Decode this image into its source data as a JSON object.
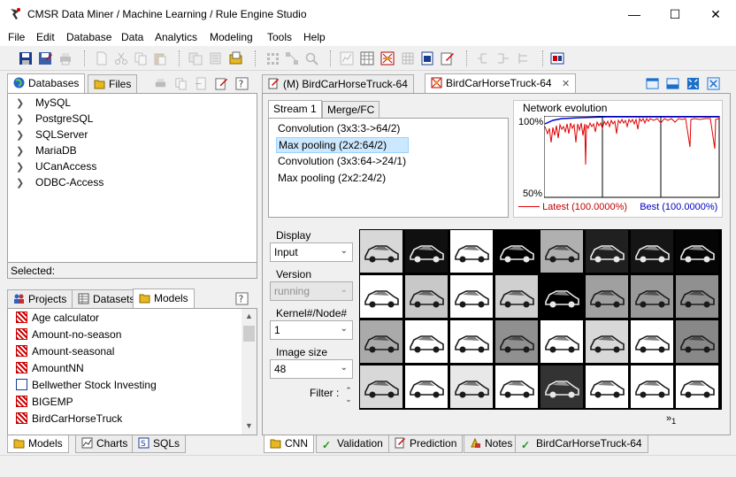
{
  "window": {
    "title": "CMSR Data Miner / Machine Learning / Rule Engine Studio"
  },
  "menu": [
    "File",
    "Edit",
    "Database",
    "Data",
    "Analytics",
    "Modeling",
    "Tools",
    "Help"
  ],
  "left_top_tabs": {
    "databases": "Databases",
    "files": "Files"
  },
  "databases": [
    "MySQL",
    "PostgreSQL",
    "SQLServer",
    "MariaDB",
    "UCanAccess",
    "ODBC-Access"
  ],
  "selected_label": "Selected:",
  "left_mid_tabs": {
    "projects": "Projects",
    "datasets": "Datasets",
    "models": "Models"
  },
  "models_list": [
    {
      "label": "Age calculator",
      "icon": "neural"
    },
    {
      "label": "Amount-no-season",
      "icon": "neural"
    },
    {
      "label": "Amount-seasonal",
      "icon": "neural"
    },
    {
      "label": "AmountNN",
      "icon": "neural"
    },
    {
      "label": "Bellwether Stock Investing",
      "icon": "doc"
    },
    {
      "label": "BIGEMP",
      "icon": "neural"
    },
    {
      "label": "BirdCarHorseTruck",
      "icon": "neural"
    }
  ],
  "left_bottom_tabs": {
    "models": "Models",
    "charts": "Charts",
    "sqls": "SQLs"
  },
  "editor_tabs": {
    "tab1": "(M) BirdCarHorseTruck-64",
    "tab2": "BirdCarHorseTruck-64"
  },
  "stream_tabs": {
    "stream1": "Stream 1",
    "merge": "Merge/FC"
  },
  "layers": [
    "Convolution (3x3:3->64/2)",
    "Max pooling (2x2:64/2)",
    "Convolution (3x3:64->24/1)",
    "Max pooling (2x2:24/2)"
  ],
  "network_evolution": {
    "title": "Network evolution",
    "y_top": "100%",
    "y_bottom": "50%",
    "latest": "Latest (100.0000%)",
    "best": "Best (100.0000%)",
    "latest_color": "#e00000",
    "best_color": "#0000e0"
  },
  "controls": {
    "display_label": "Display",
    "display_value": "Input",
    "version_label": "Version",
    "version_value": "running",
    "kernel_label": "Kernel#/Node#",
    "kernel_value": "1",
    "image_size_label": "Image size",
    "image_size_value": "48",
    "filter_label": "Filter :"
  },
  "page_indicator": "1",
  "bottom_tabs": {
    "cnn": "CNN",
    "validation": "Validation",
    "prediction": "Prediction",
    "notes": "Notes",
    "model": "BirdCarHorseTruck-64"
  }
}
